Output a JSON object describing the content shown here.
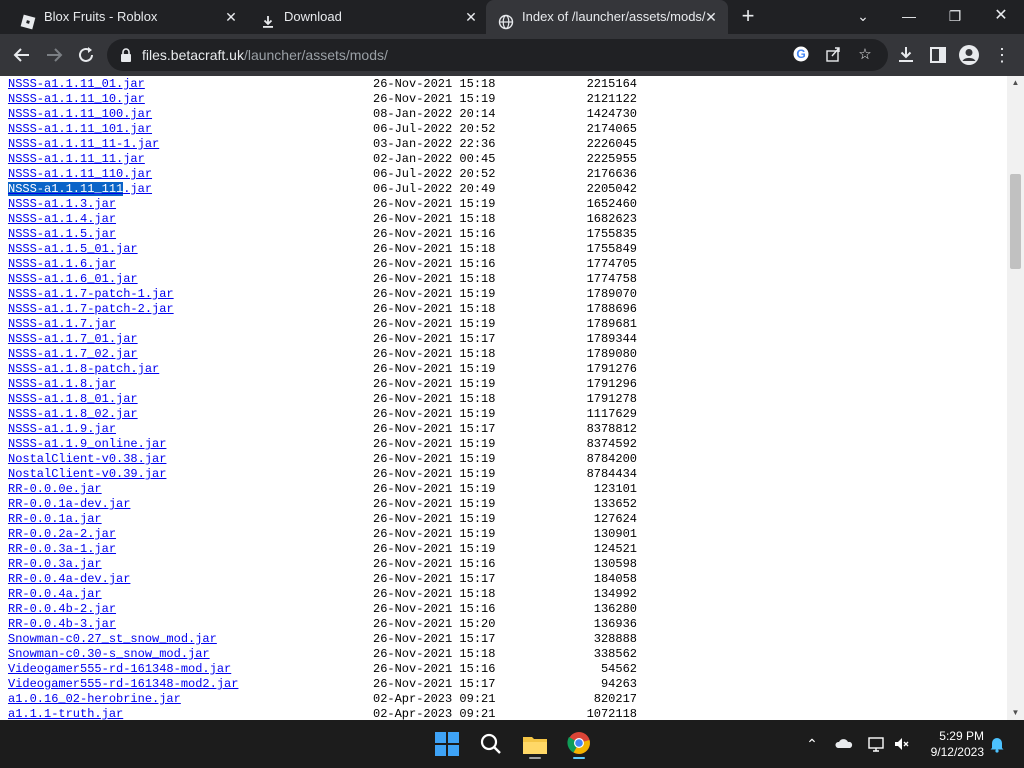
{
  "browser": {
    "tabs": [
      {
        "title": "Blox Fruits - Roblox",
        "icon": "roblox-icon"
      },
      {
        "title": "Download",
        "icon": "download-icon"
      },
      {
        "title": "Index of /launcher/assets/mods/",
        "icon": "globe-icon",
        "active": true
      }
    ],
    "url": {
      "host": "files.betacraft.uk",
      "path": "/launcher/assets/mods/"
    }
  },
  "listing": {
    "rows": [
      {
        "name": "NSSS-a1.1.11_01.jar",
        "date": "26-Nov-2021 15:18",
        "size": "2215164"
      },
      {
        "name": "NSSS-a1.1.11_10.jar",
        "date": "26-Nov-2021 15:19",
        "size": "2121122"
      },
      {
        "name": "NSSS-a1.1.11_100.jar",
        "date": "08-Jan-2022 20:14",
        "size": "1424730"
      },
      {
        "name": "NSSS-a1.1.11_101.jar",
        "date": "06-Jul-2022 20:52",
        "size": "2174065"
      },
      {
        "name": "NSSS-a1.1.11_11-1.jar",
        "date": "03-Jan-2022 22:36",
        "size": "2226045"
      },
      {
        "name": "NSSS-a1.1.11_11.jar",
        "date": "02-Jan-2022 00:45",
        "size": "2225955"
      },
      {
        "name": "NSSS-a1.1.11_110.jar",
        "date": "06-Jul-2022 20:52",
        "size": "2176636"
      },
      {
        "name": "NSSS-a1.1.11_111.jar",
        "date": "06-Jul-2022 20:49",
        "size": "2205042",
        "selected_part": "NSSS-a1.1.11_111",
        "rest_part": ".jar"
      },
      {
        "name": "NSSS-a1.1.3.jar",
        "date": "26-Nov-2021 15:19",
        "size": "1652460"
      },
      {
        "name": "NSSS-a1.1.4.jar",
        "date": "26-Nov-2021 15:18",
        "size": "1682623"
      },
      {
        "name": "NSSS-a1.1.5.jar",
        "date": "26-Nov-2021 15:16",
        "size": "1755835"
      },
      {
        "name": "NSSS-a1.1.5_01.jar",
        "date": "26-Nov-2021 15:18",
        "size": "1755849"
      },
      {
        "name": "NSSS-a1.1.6.jar",
        "date": "26-Nov-2021 15:16",
        "size": "1774705"
      },
      {
        "name": "NSSS-a1.1.6_01.jar",
        "date": "26-Nov-2021 15:18",
        "size": "1774758"
      },
      {
        "name": "NSSS-a1.1.7-patch-1.jar",
        "date": "26-Nov-2021 15:19",
        "size": "1789070"
      },
      {
        "name": "NSSS-a1.1.7-patch-2.jar",
        "date": "26-Nov-2021 15:18",
        "size": "1788696"
      },
      {
        "name": "NSSS-a1.1.7.jar",
        "date": "26-Nov-2021 15:19",
        "size": "1789681"
      },
      {
        "name": "NSSS-a1.1.7_01.jar",
        "date": "26-Nov-2021 15:17",
        "size": "1789344"
      },
      {
        "name": "NSSS-a1.1.7_02.jar",
        "date": "26-Nov-2021 15:18",
        "size": "1789080"
      },
      {
        "name": "NSSS-a1.1.8-patch.jar",
        "date": "26-Nov-2021 15:19",
        "size": "1791276"
      },
      {
        "name": "NSSS-a1.1.8.jar",
        "date": "26-Nov-2021 15:19",
        "size": "1791296"
      },
      {
        "name": "NSSS-a1.1.8_01.jar",
        "date": "26-Nov-2021 15:18",
        "size": "1791278"
      },
      {
        "name": "NSSS-a1.1.8_02.jar",
        "date": "26-Nov-2021 15:19",
        "size": "1117629"
      },
      {
        "name": "NSSS-a1.1.9.jar",
        "date": "26-Nov-2021 15:17",
        "size": "8378812"
      },
      {
        "name": "NSSS-a1.1.9_online.jar",
        "date": "26-Nov-2021 15:19",
        "size": "8374592"
      },
      {
        "name": "NostalClient-v0.38.jar",
        "date": "26-Nov-2021 15:19",
        "size": "8784200"
      },
      {
        "name": "NostalClient-v0.39.jar",
        "date": "26-Nov-2021 15:19",
        "size": "8784434"
      },
      {
        "name": "RR-0.0.0e.jar",
        "date": "26-Nov-2021 15:19",
        "size": "123101"
      },
      {
        "name": "RR-0.0.1a-dev.jar",
        "date": "26-Nov-2021 15:19",
        "size": "133652"
      },
      {
        "name": "RR-0.0.1a.jar",
        "date": "26-Nov-2021 15:19",
        "size": "127624"
      },
      {
        "name": "RR-0.0.2a-2.jar",
        "date": "26-Nov-2021 15:19",
        "size": "130901"
      },
      {
        "name": "RR-0.0.3a-1.jar",
        "date": "26-Nov-2021 15:19",
        "size": "124521"
      },
      {
        "name": "RR-0.0.3a.jar",
        "date": "26-Nov-2021 15:16",
        "size": "130598"
      },
      {
        "name": "RR-0.0.4a-dev.jar",
        "date": "26-Nov-2021 15:17",
        "size": "184058"
      },
      {
        "name": "RR-0.0.4a.jar",
        "date": "26-Nov-2021 15:18",
        "size": "134992"
      },
      {
        "name": "RR-0.0.4b-2.jar",
        "date": "26-Nov-2021 15:16",
        "size": "136280"
      },
      {
        "name": "RR-0.0.4b-3.jar",
        "date": "26-Nov-2021 15:20",
        "size": "136936"
      },
      {
        "name": "Snowman-c0.27_st_snow_mod.jar",
        "date": "26-Nov-2021 15:17",
        "size": "328888"
      },
      {
        "name": "Snowman-c0.30-s_snow_mod.jar",
        "date": "26-Nov-2021 15:18",
        "size": "338562"
      },
      {
        "name": "Videogamer555-rd-161348-mod.jar",
        "date": "26-Nov-2021 15:16",
        "size": "54562"
      },
      {
        "name": "Videogamer555-rd-161348-mod2.jar",
        "date": "26-Nov-2021 15:17",
        "size": "94263"
      },
      {
        "name": "a1.0.16_02-herobrine.jar",
        "date": "02-Apr-2023 09:21",
        "size": "820217"
      },
      {
        "name": "a1.1.1-truth.jar",
        "date": "02-Apr-2023 09:21",
        "size": "1072118"
      }
    ]
  },
  "taskbar": {
    "clock": {
      "time": "5:29 PM",
      "date": "9/12/2023"
    }
  },
  "colors": {
    "link": "#0000ee",
    "selection": "#0a64c8",
    "chrome_dark": "#202124",
    "chrome_toolbar": "#35363a"
  }
}
